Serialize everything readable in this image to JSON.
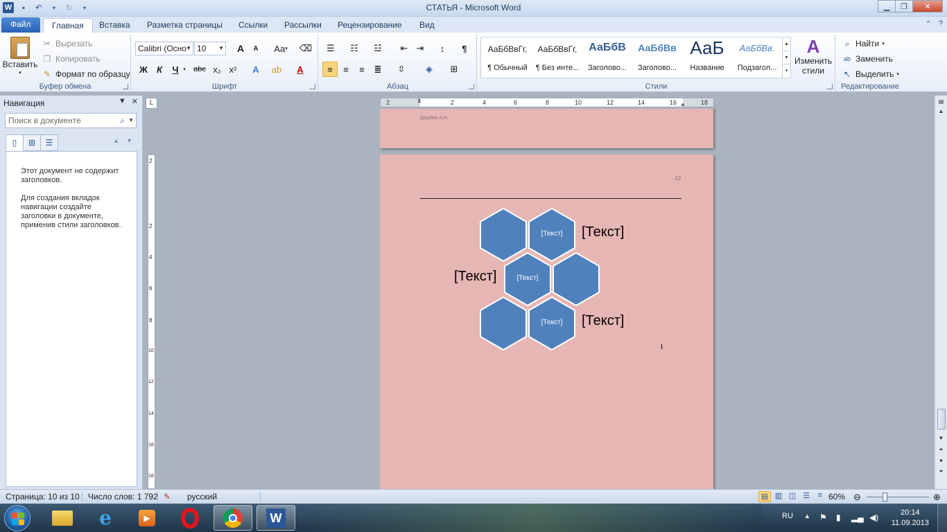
{
  "window": {
    "title": "СТАТЬЯ - Microsoft Word"
  },
  "tabs": [
    {
      "label": "Файл"
    },
    {
      "label": "Главная"
    },
    {
      "label": "Вставка"
    },
    {
      "label": "Разметка страницы"
    },
    {
      "label": "Ссылки"
    },
    {
      "label": "Рассылки"
    },
    {
      "label": "Рецензирование"
    },
    {
      "label": "Вид"
    }
  ],
  "clipboard": {
    "paste": "Вставить",
    "cut": "Вырезать",
    "copy": "Копировать",
    "format_painter": "Формат по образцу",
    "label": "Буфер обмена"
  },
  "font": {
    "name": "Calibri (Осно",
    "size": "10",
    "label": "Шрифт",
    "bold": "Ж",
    "italic": "К",
    "underline": "Ч",
    "strike": "abc",
    "subscript": "x₂",
    "superscript": "x²",
    "grow": "A",
    "shrink": "A",
    "case": "Aa"
  },
  "paragraph": {
    "label": "Абзац",
    "marks": "¶"
  },
  "styles": {
    "label": "Стили",
    "items": [
      {
        "sample": "АаБбВвГг,",
        "name": "¶ Обычный"
      },
      {
        "sample": "АаБбВвГг,",
        "name": "¶ Без инте..."
      },
      {
        "sample": "АаБбВ",
        "name": "Заголово..."
      },
      {
        "sample": "АаБбВв",
        "name": "Заголово..."
      },
      {
        "sample": "АаБ",
        "name": "Название"
      },
      {
        "sample": "АаБбВв.",
        "name": "Подзагол..."
      }
    ],
    "change_line1": "Изменить",
    "change_line2": "стили"
  },
  "editing": {
    "label": "Редактирование",
    "find": "Найти",
    "replace": "Заменить",
    "select": "Выделить"
  },
  "nav": {
    "title": "Навигация",
    "search_placeholder": "Поиск в документе",
    "msg1": "Этот документ не содержит заголовков.",
    "msg2": "Для создания вкладок навигации создайте заголовки в документе, применив стили заголовков."
  },
  "ruler": {
    "h_labels": [
      "2",
      "2",
      "4",
      "6",
      "8",
      "10",
      "12",
      "14",
      "16",
      "18"
    ],
    "v_labels": [
      "2",
      "2",
      "4",
      "6",
      "8",
      "10",
      "12",
      "14",
      "16",
      "18"
    ]
  },
  "document": {
    "footer_author": "Щербак А.Н.",
    "page_number": "10",
    "hex_labels": [
      "[Текст]",
      "[Текст]",
      "[Текст]"
    ],
    "side_labels": [
      "[Текст]",
      "[Текст]",
      "[Текст]"
    ],
    "colors": {
      "page": "#e6b6b4",
      "hexagon": "#4f81bd",
      "hexagon_border": "#ffffff"
    }
  },
  "status": {
    "page": "Страница: 10 из 10",
    "words": "Число слов: 1 792",
    "language": "русский",
    "zoom": "60%"
  },
  "taskbar": {
    "lang": "RU",
    "time": "20:14",
    "date": "11.09.2013"
  }
}
